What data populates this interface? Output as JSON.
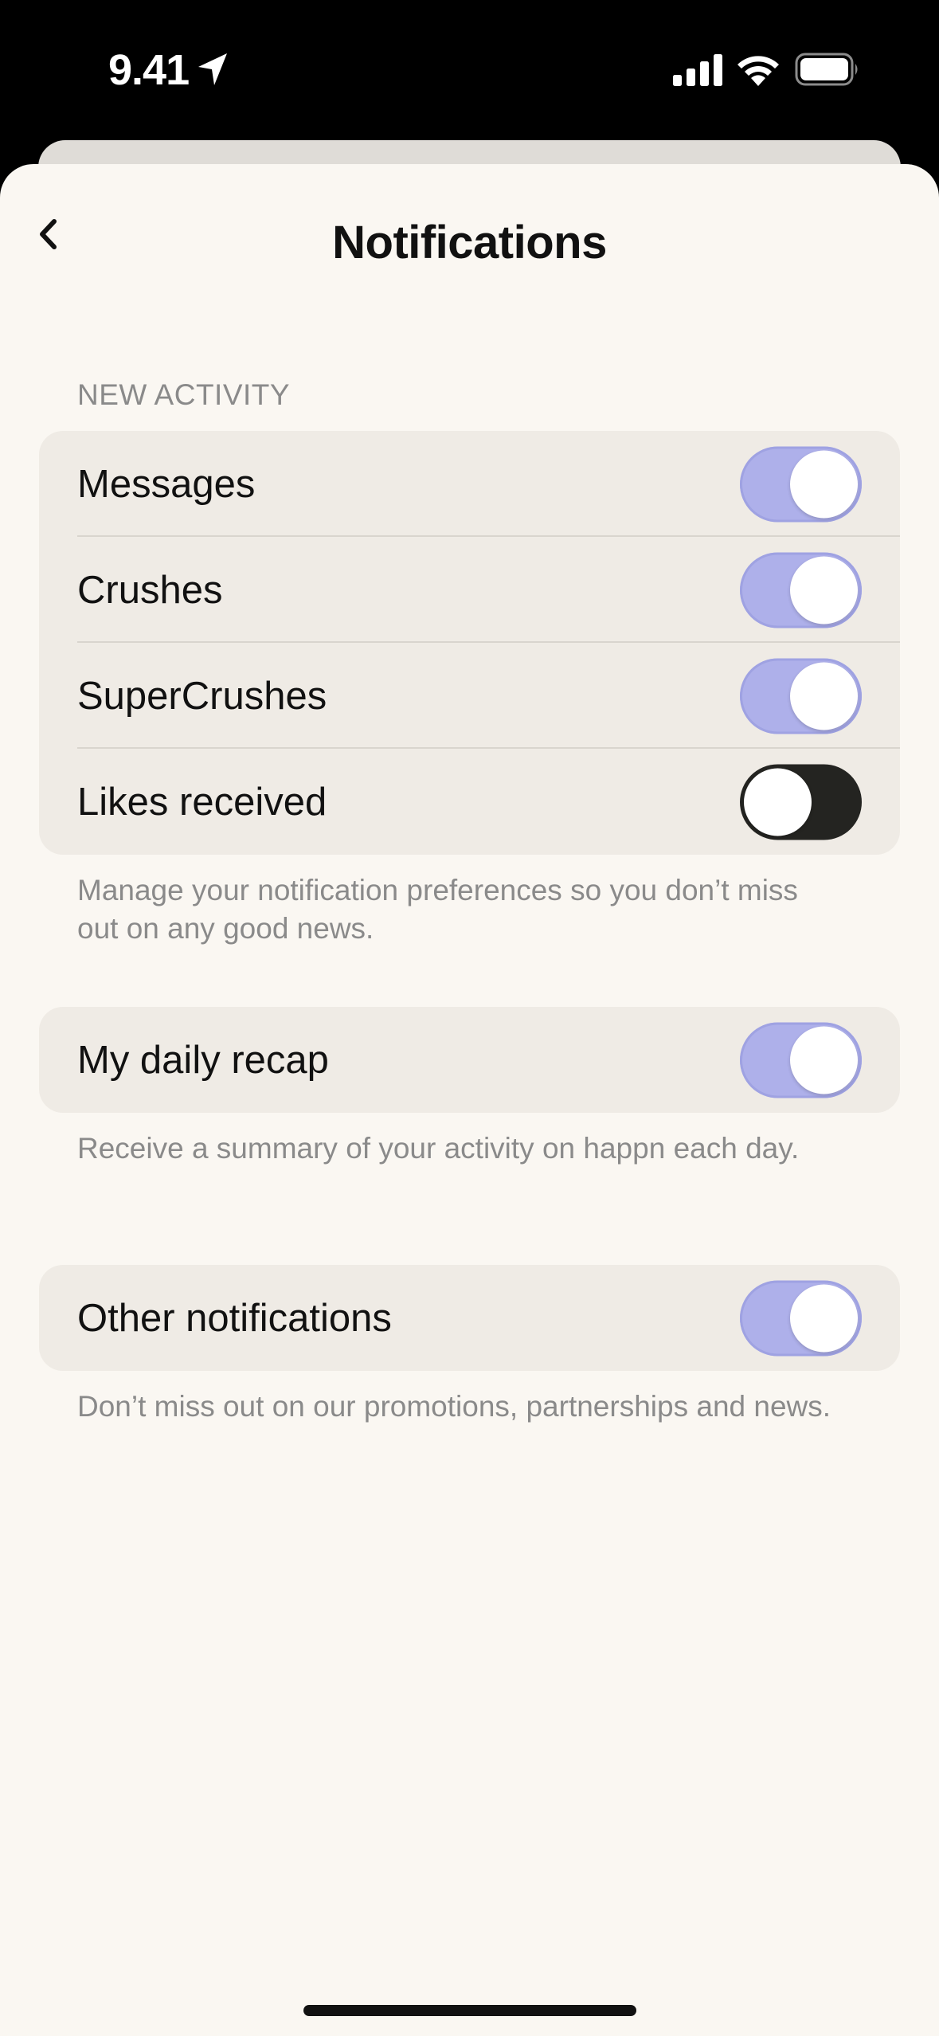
{
  "status_bar": {
    "time": "9.41",
    "icons": [
      "location-arrow-icon",
      "cellular-signal-icon",
      "wifi-icon",
      "battery-icon"
    ]
  },
  "header": {
    "title": "Notifications",
    "back_icon": "chevron-left-icon"
  },
  "new_activity": {
    "section_title": "NEW ACTIVITY",
    "items": [
      {
        "label": "Messages",
        "enabled": true
      },
      {
        "label": "Crushes",
        "enabled": true
      },
      {
        "label": "SuperCrushes",
        "enabled": true
      },
      {
        "label": "Likes received",
        "enabled": false
      }
    ],
    "footer": "Manage your notification preferences so you don’t miss out on any good news."
  },
  "daily_recap": {
    "label": "My daily recap",
    "enabled": true,
    "footer": "Receive a summary of your activity on happn each day."
  },
  "other_notifications": {
    "label": "Other notifications",
    "enabled": true,
    "footer": "Don’t miss out on our promotions, partnerships and news."
  },
  "colors": {
    "background": "#faf7f2",
    "group_background": "#efebe5",
    "toggle_on": "#aeb0ea",
    "toggle_off": "#242421",
    "secondary_text": "#8a8a8a"
  }
}
